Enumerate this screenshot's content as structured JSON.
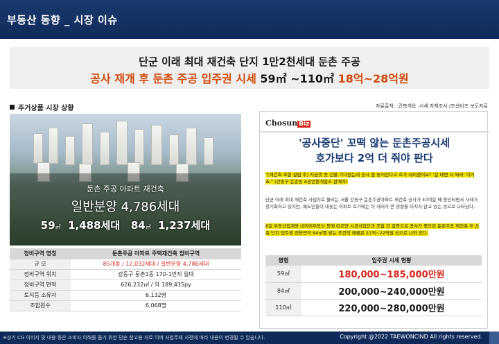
{
  "header": {
    "title": "부동산 동향 _ 시장 이슈"
  },
  "headline": {
    "line1": "단군 이래 최대 재건축 단지 1만2천세대 둔촌 주공",
    "line2_red": "공사 재개 후 둔촌 주공 입주권 시세",
    "line2_size": "59㎡ ~110㎡",
    "line2_price": "18억~28억원"
  },
  "section": {
    "label": "주거상품 시장 상황"
  },
  "source_text": "자료출처: .건축개요 .시세 자체조사 /조선비즈 보도자료",
  "image_caption": {
    "line1": "둔촌 주공 아파트 재건축",
    "line2": "일반분양 4,786세대",
    "line3_a": "59",
    "line3_a_unit": "㎡",
    "line3_b": "1,488세대",
    "line3_c": "84",
    "line3_c_unit": "㎡",
    "line3_d": "1,237세대"
  },
  "project_table": {
    "header_key": "정비구역 명칭",
    "header_val": "둔촌주공 아파트 주택재건축 정비구역",
    "rows": [
      {
        "key": "규 모",
        "val": "85개동 / 12,032세대 / 일반분양 4,786세대"
      },
      {
        "key": "정비구역 위치",
        "val": "강동구 둔촌1동 170-1번지 일대"
      },
      {
        "key": "정비구역 면적",
        "val": "626,232㎡ / 약 189,435py"
      },
      {
        "key": "토지등 소유자",
        "val": "6,132명"
      },
      {
        "key": "조합원수",
        "val": "6,068명"
      }
    ]
  },
  "article": {
    "logo": "Chosun",
    "logo_biz": "Biz",
    "title1": "'공사중단' 꼬떡 않는 둔촌주공시세",
    "title2": "호가보다 2억 더 줘야 판다",
    "quote": "\"[재건축 조합 설립 후] 지금껏 못 년을 기다렸는데 공사 좀 늦어진다고 호가 내리겠어요? '살 테면 사 봐라' 이거죠.\" (강동구 둔촌동 A공인중개업소 관계자)",
    "body1": "단군 이래 최대 재건축 사업지로 불리는 서울 강동구 둔촌주공아파트 재건축 공사가 40여일 째 중단되면서 사태가 장기화하고 있지만, 매도인들이 내놓는 아파트 호가에는 이 사태가 큰 영향을 미치지 않고 있는 것으로 나타났다.",
    "body2": "8일 부동산업계와 네이버부동산 등에 따르면 시공사업단과 조합 간 갈등으로 공사가 중단된 둔촌주공 재건축 후 신축 단지 입주권 전용면적 84㎡를 받는 조건의 매물은 21억~22억원 선으로 나와 있다.",
    "table_header_key": "평형",
    "table_header_val": "입주권 시세 현황",
    "rows": [
      {
        "key": "59㎡",
        "val": "180,000~185,000만원"
      },
      {
        "key": "84㎡",
        "val": "200,000~240,000만원"
      },
      {
        "key": "110㎡",
        "val": "220,000~280,000만원"
      }
    ]
  },
  "footer": {
    "note": "※상기 CG 이미지 및 내용 등은 소비자 이해를 돕기 위한 단순 참고용 자료 이며 사업주체 사정에 따라 내용이 변경될 수 있습니다.",
    "copyright": "Copyright @2022 TAEWONCIND All rights reserved."
  },
  "colors": {
    "navy": "#0e2a58",
    "accent_red": "#d24a0a",
    "price_red": "#d8261a",
    "title_blue": "#1b3b73"
  }
}
